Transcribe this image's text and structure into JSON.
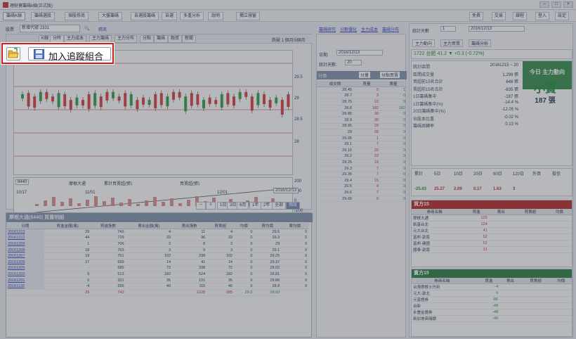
{
  "window": {
    "title": "理財寶籌碼k線(正式版)"
  },
  "menu": {
    "tabs": [
      "籌碼K線",
      "籌碼選股",
      "個股券商",
      "大盤籌碼",
      "自選股籌碼",
      "自選",
      "多重分析",
      "說明",
      "獨立視窗"
    ],
    "right": [
      "免費",
      "交易",
      "課程",
      "設置",
      "登入",
      "設定"
    ]
  },
  "toolbar": {
    "stock_label": "股票",
    "stock_value": "2331",
    "stock_name": "精英",
    "combo_label": "新增代號",
    "links": [
      "籌碼研究",
      "分數優化",
      "主力成本",
      "籌碼分布"
    ]
  },
  "chart_tabs": [
    "K線",
    "分時",
    "主力成本",
    "主力籌碼",
    "主力分布",
    "分點",
    "籌碼",
    "融資",
    "新聞"
  ],
  "chart_note": "跌破 1 個月/5個月",
  "kline": {
    "price_ticks": [
      "29.5",
      "29",
      "28.5",
      "28"
    ],
    "date_labels": [
      "10/17",
      "11/01",
      "12/01"
    ],
    "date_box": "2016/12/13"
  },
  "sub_chart": {
    "label": "8440",
    "legend": [
      "摩根大通",
      "累計買賣超(張)",
      "買賣超(張)"
    ],
    "ticks": [
      "200",
      "100",
      "0",
      "-100"
    ]
  },
  "period_buttons": [
    "1日",
    "3日",
    "6月",
    "1年",
    "2年",
    "全部",
    "預設"
  ],
  "broker_table": {
    "title": "摩根大通(8440) 買賣明細",
    "columns": [
      "日期",
      "買進金額(萬)",
      "買進張數",
      "賣出金額(萬)",
      "賣出張數",
      "買賣超",
      "均價",
      "買均價",
      "賣均價"
    ],
    "rows": [
      [
        "20161213",
        "29",
        "743",
        "4",
        "11",
        "4",
        "0",
        "29.5",
        "0"
      ],
      [
        "20161212",
        "44",
        "729",
        "33",
        "96",
        "33",
        "0",
        "29.3",
        "0"
      ],
      [
        "20161209",
        "1",
        "706",
        "3",
        "8",
        "3",
        "0",
        "29",
        "0"
      ],
      [
        "20161208",
        "18",
        "703",
        "3",
        "9",
        "3",
        "0",
        "29.1",
        "0"
      ],
      [
        "20161207",
        "19",
        "701",
        "102",
        "298",
        "102",
        "0",
        "29.25",
        "0"
      ],
      [
        "20161206",
        "27",
        "599",
        "14",
        "41",
        "14",
        "0",
        "29.37",
        "0"
      ],
      [
        "20161205",
        "-",
        "585",
        "72",
        "208",
        "72",
        "0",
        "28.92",
        "0"
      ],
      [
        "20161202",
        "9",
        "513",
        "182",
        "524",
        "182",
        "0",
        "28.81",
        "0"
      ],
      [
        "20161201",
        "0",
        "331",
        "35",
        "101",
        "35",
        "0",
        "28.86",
        "0"
      ],
      [
        "20161130",
        "-4",
        "296",
        "40",
        "115",
        "40",
        "0",
        "28.8",
        "0"
      ]
    ],
    "totals": [
      "",
      "29",
      "743",
      "",
      "1028",
      "285",
      "29.2",
      "28.93"
    ]
  },
  "mid_panel": {
    "date_label": "日期:",
    "date_value": "2016/12/13",
    "days_label": "統計天數:",
    "days_value": "20",
    "tabs": [
      "分價",
      "分量",
      "分點買賣"
    ],
    "columns": [
      "成交價",
      "買量",
      "賣量"
    ],
    "rows": [
      [
        "28.45",
        "0",
        "1"
      ],
      [
        "28.7",
        "3",
        "0"
      ],
      [
        "28.75",
        "10",
        "0"
      ],
      [
        "28.8",
        "182",
        "182"
      ],
      [
        "28.85",
        "39",
        "0"
      ],
      [
        "28.9",
        "30",
        "0"
      ],
      [
        "28.95",
        "29",
        "0"
      ],
      [
        "29",
        "28",
        "0"
      ],
      [
        "29.05",
        "1",
        "0"
      ],
      [
        "29.1",
        "7",
        "0"
      ],
      [
        "29.15",
        "20",
        "0"
      ],
      [
        "29.2",
        "23",
        "0"
      ],
      [
        "29.25",
        "19",
        "0"
      ],
      [
        "29.3",
        "7",
        "0"
      ],
      [
        "29.35",
        "7",
        "0"
      ],
      [
        "29.4",
        "15",
        "0"
      ],
      [
        "29.5",
        "4",
        "0"
      ],
      [
        "29.6",
        "7",
        "0"
      ],
      [
        "29.65",
        "0",
        "0"
      ]
    ]
  },
  "right": {
    "days_label": "統計天數",
    "days_value": "1",
    "date_value": "2016/12/13",
    "tabs": [
      "主力動向",
      "主力買賣",
      "籌碼分析"
    ],
    "quote": "1722 台肥 41.2 ▼ +0.3 (-0.72%)",
    "info": [
      [
        "統計區間",
        "20161215 ~ 20"
      ],
      [
        "區間成交量",
        "1,299 張"
      ],
      [
        "買超前15名合計",
        "648 張"
      ],
      [
        "賣超前15名合計",
        "-835 張"
      ],
      [
        "1日籌碼集中",
        "-187 張"
      ],
      [
        "1日籌碼集中(%)",
        "-14.4 %"
      ],
      [
        "20日籌碼集中(%)",
        "-12.05 %"
      ],
      [
        "佔股本比重",
        "-0.02 %"
      ],
      [
        "籌碼周轉率",
        "0.13 %"
      ]
    ],
    "big_title": "今日 主力動向",
    "big_value": "小賣",
    "big_sub": "187 張",
    "stats_head": [
      "累計",
      "5日",
      "10日",
      "20日",
      "60日",
      "120日",
      "外資",
      "投信"
    ],
    "stats": [
      "-25.63",
      "25.27",
      "2.09",
      "0.17",
      "1.63",
      "3"
    ],
    "buy_title": "買方15",
    "sell_title": "賣方15",
    "broker_cols": [
      "券商名稱",
      "",
      "買進",
      "賣出",
      "買賣超",
      "均價"
    ],
    "buyers": [
      [
        "摩根大通",
        "125"
      ],
      [
        "凱基台北",
        "124"
      ],
      [
        "元大台北",
        "41"
      ],
      [
        "富邦-敦南",
        "52"
      ],
      [
        "富邦-建國",
        "52"
      ],
      [
        "國泰-敦南",
        "31"
      ]
    ],
    "sellers": [
      [
        "台灣摩根士丹利",
        "-4"
      ],
      [
        "元大-敦北",
        "0"
      ],
      [
        "元富證券",
        "-86"
      ],
      [
        "台新",
        "-48"
      ],
      [
        "永豐金證券",
        "-48"
      ],
      [
        "新加坡商瑞銀",
        "-45"
      ]
    ]
  },
  "popup": {
    "add_label": "加入追蹤組合"
  }
}
